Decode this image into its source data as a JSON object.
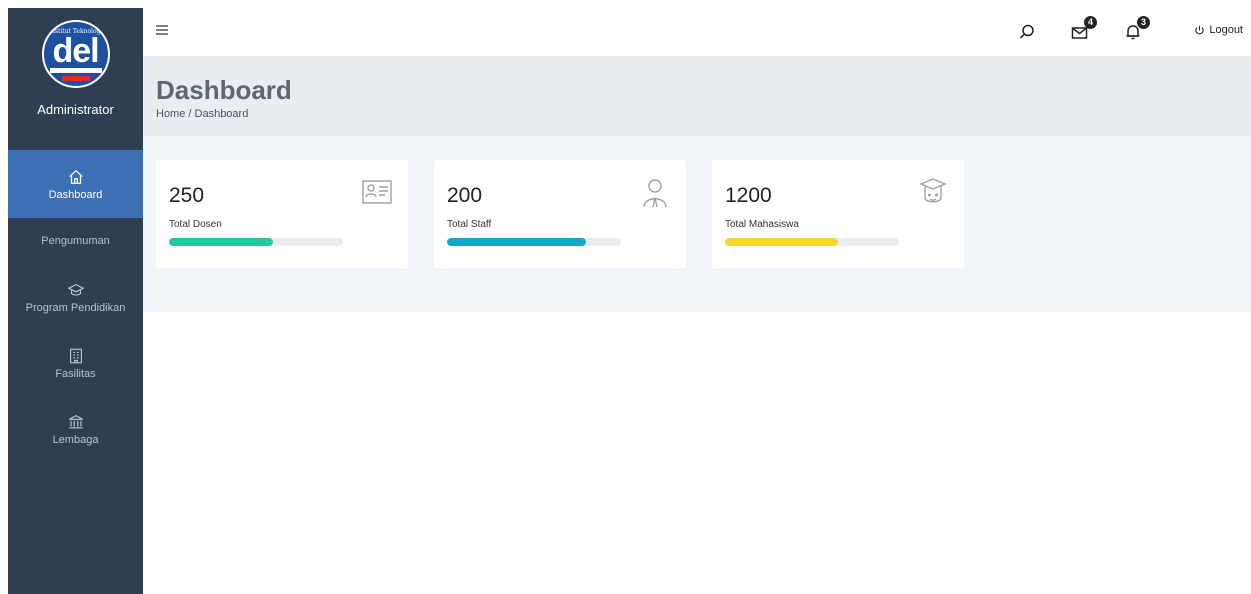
{
  "sidebar": {
    "logo_text": "del",
    "logo_top_text": "Institut Teknologi",
    "role": "Administrator",
    "items": [
      {
        "label": "Dashboard",
        "icon": "home-icon",
        "active": true
      },
      {
        "label": "Pengumuman",
        "icon": "",
        "active": false
      },
      {
        "label": "Program Pendidikan",
        "icon": "graduation-cap-icon",
        "active": false
      },
      {
        "label": "Fasilitas",
        "icon": "building-icon",
        "active": false
      },
      {
        "label": "Lembaga",
        "icon": "institution-icon",
        "active": false
      }
    ]
  },
  "topbar": {
    "menu_icon": "hamburger-icon",
    "search_icon": "search-icon",
    "messages_badge": "4",
    "notifications_badge": "3",
    "logout_label": "Logout"
  },
  "header": {
    "title": "Dashboard",
    "breadcrumb": "Home / Dashboard"
  },
  "cards": [
    {
      "value": "250",
      "label": "Total Dosen",
      "icon": "id-card-icon",
      "progress": 0.6,
      "color": "#26c6a0"
    },
    {
      "value": "200",
      "label": "Total Staff",
      "icon": "user-icon",
      "progress": 0.8,
      "color": "#17a8c9"
    },
    {
      "value": "1200",
      "label": "Total Mahasiswa",
      "icon": "student-icon",
      "progress": 0.65,
      "color": "#f5d531"
    }
  ],
  "colors": {
    "sidebar_bg": "#2f3e52",
    "active_nav": "#3c6fb4",
    "header_bg": "#e9edf2",
    "content_bg": "#f1f4f8"
  }
}
